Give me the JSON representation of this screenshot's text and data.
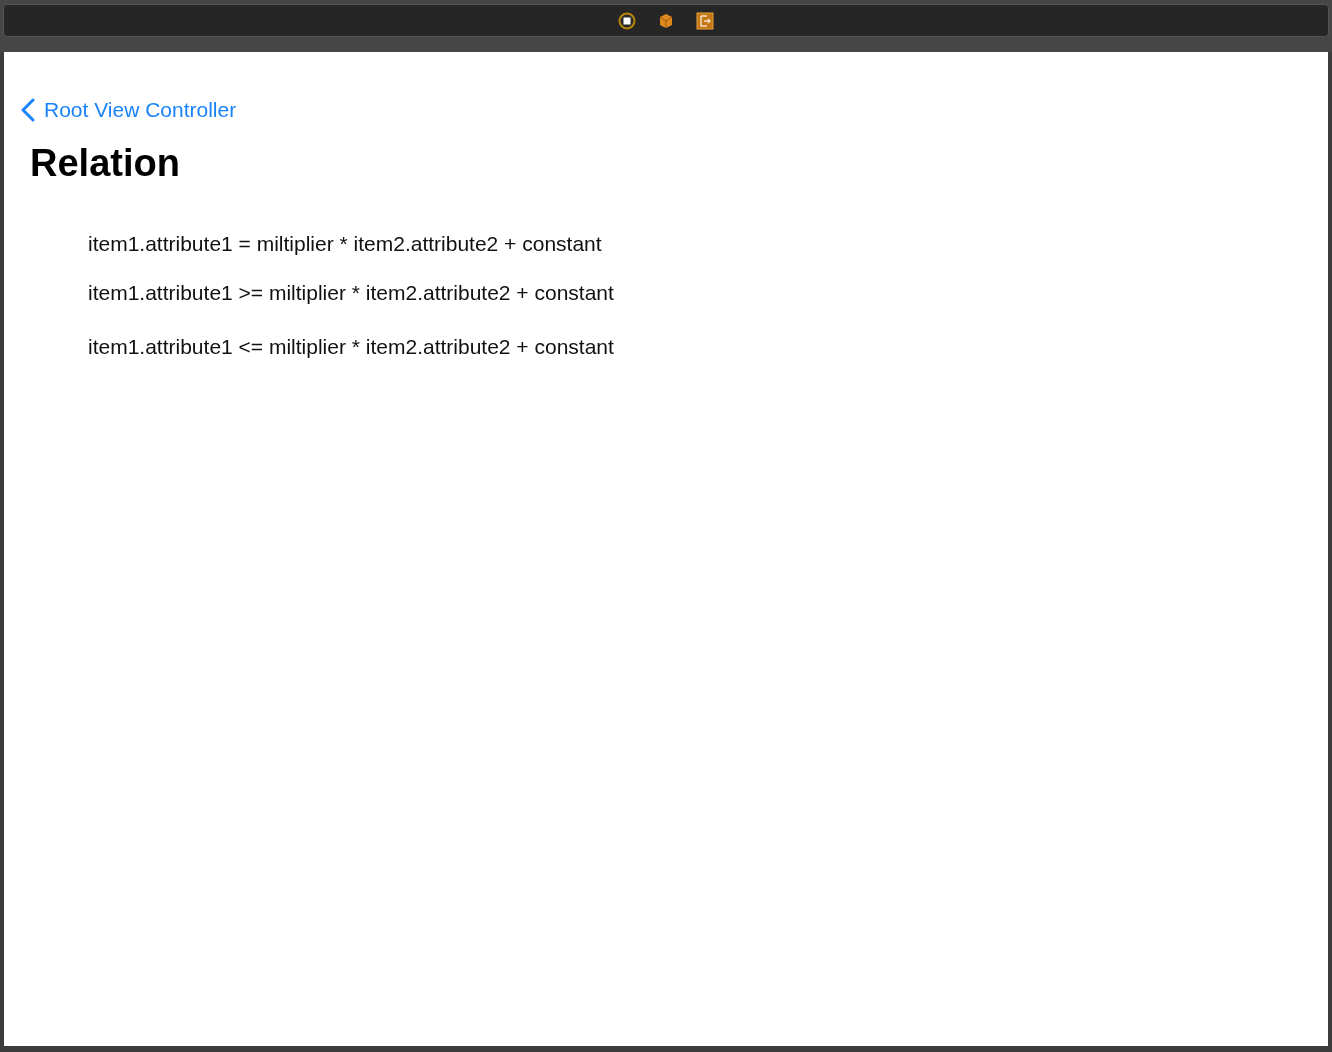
{
  "nav": {
    "back_label": "Root View Controller",
    "title": "Relation"
  },
  "lines": [
    "item1.attribute1 = miltiplier * item2.attribute2 + constant",
    "item1.attribute1 >= miltiplier * item2.attribute2 + constant",
    "item1.attribute1 <= miltiplier * item2.attribute2 + constant"
  ]
}
